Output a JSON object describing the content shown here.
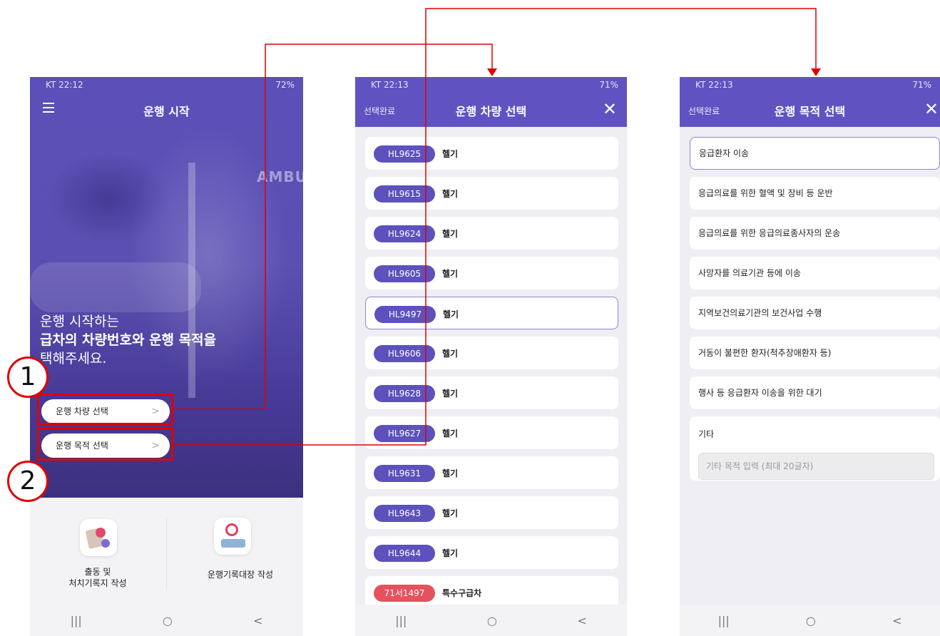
{
  "screen1": {
    "status": {
      "left": "KT 22:12",
      "right": "72%"
    },
    "title": "운행 시작",
    "ambulance_text": "AMBU",
    "hero_line1": "운행 시작하는",
    "hero_line2": "급차의 차량번호와 운행 목적을",
    "hero_line3": "택해주세요.",
    "btn_vehicle": "운행 차량 선택",
    "btn_purpose": "운행 목적 선택",
    "menu1_line1": "출동 및",
    "menu1_line2": "처치기록지 작성",
    "menu2": "운행기록대장 작성",
    "nav": [
      "|||",
      "○",
      "<"
    ]
  },
  "screen2": {
    "status": {
      "left": "KT 22:13",
      "right": "71%"
    },
    "done": "선택완료",
    "title": "운행 차량 선택",
    "close": "✕",
    "vehicles": [
      {
        "id": "HL9625",
        "type": "헬기"
      },
      {
        "id": "HL9615",
        "type": "헬기"
      },
      {
        "id": "HL9624",
        "type": "헬기"
      },
      {
        "id": "HL9605",
        "type": "헬기"
      },
      {
        "id": "HL9497",
        "type": "헬기"
      },
      {
        "id": "HL9606",
        "type": "헬기"
      },
      {
        "id": "HL9628",
        "type": "헬기"
      },
      {
        "id": "HL9627",
        "type": "헬기"
      },
      {
        "id": "HL9631",
        "type": "헬기"
      },
      {
        "id": "HL9643",
        "type": "헬기"
      },
      {
        "id": "HL9644",
        "type": "헬기"
      },
      {
        "id": "71서1497",
        "type": "특수구급차"
      }
    ],
    "selected_index": 4,
    "nav": [
      "|||",
      "○",
      "<"
    ]
  },
  "screen3": {
    "status": {
      "left": "KT 22:13",
      "right": "71%"
    },
    "done": "선택완료",
    "title": "운행 목적 선택",
    "close": "✕",
    "purposes": [
      "응급환자 이송",
      "응급의료를 위한 혈액 및 장비 등 운반",
      "응급의료를 위한 응급의료종사자의 운송",
      "사망자를 의료기관 등에 이송",
      "지역보건의료기관의 보건사업 수행",
      "거동이 불편한 환자(척추장애환자 등)",
      "행사 등 응급환자 이송을 위한 대기"
    ],
    "selected_index": 0,
    "etc_label": "기타",
    "etc_placeholder": "기타 목적 입력 (최대 20글자)",
    "nav": [
      "|||",
      "○",
      "<"
    ]
  },
  "annotations": {
    "n1": "1",
    "n2": "2"
  },
  "colors": {
    "header": "#6053c1",
    "chip": "#5d51bd",
    "chip_special": "#e5525d",
    "annotation": "#e00000"
  }
}
